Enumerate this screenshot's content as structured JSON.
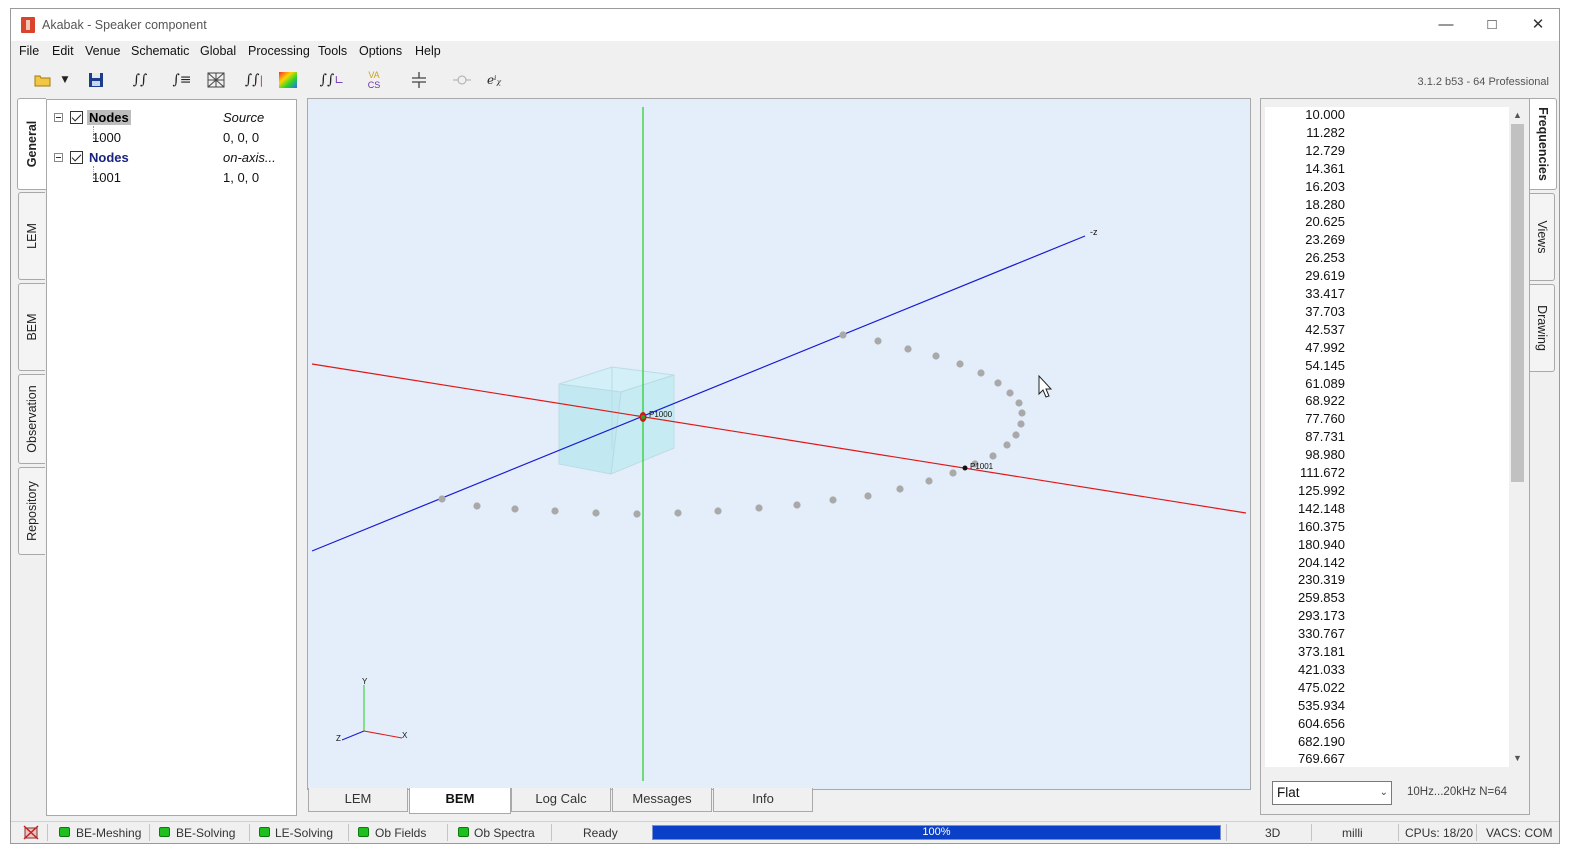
{
  "window": {
    "title": "Akabak - Speaker component",
    "minimize_icon": "minimize-icon",
    "maximize_icon": "maximize-icon",
    "close_icon": "close-icon"
  },
  "menu": [
    "File",
    "Edit",
    "Venue",
    "Schematic",
    "Global",
    "Processing",
    "Tools",
    "Options",
    "Help"
  ],
  "toolbar": {
    "version": "3.1.2 b53 - 64 Professional",
    "icons": [
      "open-folder-icon",
      "dropdown-arrow-icon",
      "save-icon",
      "integral-icon",
      "integral-list-icon",
      "mesh-icon",
      "integral-bars-icon",
      "color-map-icon",
      "integral-plot-icon",
      "vacs-icon",
      "capacitor-icon",
      "resistor-icon",
      "euler-icon"
    ],
    "vacs_top": "VA",
    "vacs_bottom": "CS",
    "euler": "eⁱᵪ"
  },
  "left_tabs": [
    "General",
    "LEM",
    "BEM",
    "Observation",
    "Repository"
  ],
  "tree": [
    {
      "label": "Nodes",
      "desc": "Source",
      "children": [
        {
          "id": "1000",
          "value": "0, 0, 0"
        }
      ]
    },
    {
      "label": "Nodes",
      "desc": "on-axis...",
      "children": [
        {
          "id": "1001",
          "value": "1, 0, 0"
        }
      ]
    }
  ],
  "viewport": {
    "axis_labels": {
      "z_far": "-z",
      "x": "X",
      "y": "Y",
      "z": "Z"
    },
    "point_labels": {
      "p1000": "P1000",
      "p1001": "P1001"
    },
    "colors": {
      "background": "#e3eefa",
      "x_axis": "#e01818",
      "y_axis": "#22cc22",
      "z_axis": "#1a1ad0",
      "box": "#bfe8f2",
      "points": "#a9a9a9"
    }
  },
  "bottom_tabs": [
    "LEM",
    "BEM",
    "Log Calc",
    "Messages",
    "Info"
  ],
  "right_tabs": [
    "Frequencies",
    "Views",
    "Drawing"
  ],
  "frequencies": [
    "10.000",
    "11.282",
    "12.729",
    "14.361",
    "16.203",
    "18.280",
    "20.625",
    "23.269",
    "26.253",
    "29.619",
    "33.417",
    "37.703",
    "42.537",
    "47.992",
    "54.145",
    "61.089",
    "68.922",
    "77.760",
    "87.731",
    "98.980",
    "111.672",
    "125.992",
    "142.148",
    "160.375",
    "180.940",
    "204.142",
    "230.319",
    "259.853",
    "293.173",
    "330.767",
    "373.181",
    "421.033",
    "475.022",
    "535.934",
    "604.656",
    "682.190",
    "769.667"
  ],
  "freq_controls": {
    "distribution": "Flat",
    "info": "10Hz...20kHz   N=64"
  },
  "status": {
    "items": [
      "BE-Meshing",
      "BE-Solving",
      "LE-Solving",
      "Ob Fields",
      "Ob Spectra"
    ],
    "state": "Ready",
    "progress": "100%",
    "progress_value": 1.0,
    "view_mode": "3D",
    "unit": "milli",
    "cpus": "CPUs: 18/20",
    "vacs": "VACS: COM"
  }
}
